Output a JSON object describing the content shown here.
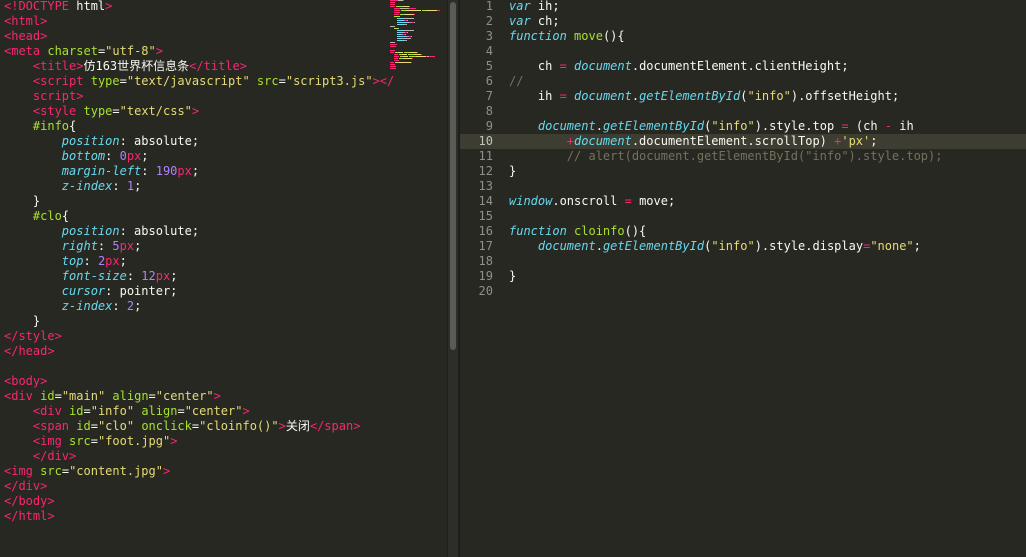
{
  "editor": {
    "left_pane": {
      "lines": [
        [
          [
            "tag",
            "<!DOCTYPE"
          ],
          [
            "pl",
            " html"
          ],
          [
            "tag",
            ">"
          ]
        ],
        [
          [
            "tag",
            "<html>"
          ]
        ],
        [
          [
            "tag",
            "<head>"
          ]
        ],
        [
          [
            "tag",
            "<meta"
          ],
          [
            "pl",
            " "
          ],
          [
            "attr",
            "charset"
          ],
          [
            "pl",
            "="
          ],
          [
            "str",
            "\"utf-8\""
          ],
          [
            "tag",
            ">"
          ]
        ],
        [
          [
            "pl",
            "    "
          ],
          [
            "tag",
            "<title>"
          ],
          [
            "pl",
            "仿163世界杯信息条"
          ],
          [
            "tag",
            "</title>"
          ]
        ],
        [
          [
            "pl",
            "    "
          ],
          [
            "tag",
            "<script"
          ],
          [
            "pl",
            " "
          ],
          [
            "attr",
            "type"
          ],
          [
            "pl",
            "="
          ],
          [
            "str",
            "\"text/javascript\""
          ],
          [
            "pl",
            " "
          ],
          [
            "attr",
            "src"
          ],
          [
            "pl",
            "="
          ],
          [
            "str",
            "\"script3.js\""
          ],
          [
            "tag",
            ">"
          ],
          [
            "tag",
            "</"
          ]
        ],
        [
          [
            "pl",
            "    "
          ],
          [
            "tag",
            "script"
          ],
          [
            "tag",
            ">"
          ]
        ],
        [
          [
            "pl",
            "    "
          ],
          [
            "tag",
            "<style"
          ],
          [
            "pl",
            " "
          ],
          [
            "attr",
            "type"
          ],
          [
            "pl",
            "="
          ],
          [
            "str",
            "\"text/css\""
          ],
          [
            "tag",
            ">"
          ]
        ],
        [
          [
            "pl",
            "    "
          ],
          [
            "attr",
            "#info"
          ],
          [
            "pl",
            "{"
          ]
        ],
        [
          [
            "pl",
            "        "
          ],
          [
            "prop",
            "position"
          ],
          [
            "pl",
            ": absolute;"
          ]
        ],
        [
          [
            "pl",
            "        "
          ],
          [
            "prop",
            "bottom"
          ],
          [
            "pl",
            ": "
          ],
          [
            "num",
            "0"
          ],
          [
            "op",
            "px"
          ],
          [
            "pl",
            ";"
          ]
        ],
        [
          [
            "pl",
            "        "
          ],
          [
            "prop",
            "margin-left"
          ],
          [
            "pl",
            ": "
          ],
          [
            "num",
            "190"
          ],
          [
            "op",
            "px"
          ],
          [
            "pl",
            ";"
          ]
        ],
        [
          [
            "pl",
            "        "
          ],
          [
            "prop",
            "z-index"
          ],
          [
            "pl",
            ": "
          ],
          [
            "num",
            "1"
          ],
          [
            "pl",
            ";"
          ]
        ],
        [
          [
            "pl",
            "    }"
          ]
        ],
        [
          [
            "pl",
            "    "
          ],
          [
            "attr",
            "#clo"
          ],
          [
            "pl",
            "{"
          ]
        ],
        [
          [
            "pl",
            "        "
          ],
          [
            "prop",
            "position"
          ],
          [
            "pl",
            ": absolute;"
          ]
        ],
        [
          [
            "pl",
            "        "
          ],
          [
            "prop",
            "right"
          ],
          [
            "pl",
            ": "
          ],
          [
            "num",
            "5"
          ],
          [
            "op",
            "px"
          ],
          [
            "pl",
            ";"
          ]
        ],
        [
          [
            "pl",
            "        "
          ],
          [
            "prop",
            "top"
          ],
          [
            "pl",
            ": "
          ],
          [
            "num",
            "2"
          ],
          [
            "op",
            "px"
          ],
          [
            "pl",
            ";"
          ]
        ],
        [
          [
            "pl",
            "        "
          ],
          [
            "prop",
            "font-size"
          ],
          [
            "pl",
            ": "
          ],
          [
            "num",
            "12"
          ],
          [
            "op",
            "px"
          ],
          [
            "pl",
            ";"
          ]
        ],
        [
          [
            "pl",
            "        "
          ],
          [
            "prop",
            "cursor"
          ],
          [
            "pl",
            ": pointer;"
          ]
        ],
        [
          [
            "pl",
            "        "
          ],
          [
            "prop",
            "z-index"
          ],
          [
            "pl",
            ": "
          ],
          [
            "num",
            "2"
          ],
          [
            "pl",
            ";"
          ]
        ],
        [
          [
            "pl",
            "    }"
          ]
        ],
        [
          [
            "tag",
            "</style>"
          ]
        ],
        [
          [
            "tag",
            "</head>"
          ]
        ],
        [],
        [
          [
            "tag",
            "<body>"
          ]
        ],
        [
          [
            "tag",
            "<div"
          ],
          [
            "pl",
            " "
          ],
          [
            "attr",
            "id"
          ],
          [
            "pl",
            "="
          ],
          [
            "str",
            "\"main\""
          ],
          [
            "pl",
            " "
          ],
          [
            "attr",
            "align"
          ],
          [
            "pl",
            "="
          ],
          [
            "str",
            "\"center\""
          ],
          [
            "tag",
            ">"
          ]
        ],
        [
          [
            "pl",
            "    "
          ],
          [
            "tag",
            "<div"
          ],
          [
            "pl",
            " "
          ],
          [
            "attr",
            "id"
          ],
          [
            "pl",
            "="
          ],
          [
            "str",
            "\"info\""
          ],
          [
            "pl",
            " "
          ],
          [
            "attr",
            "align"
          ],
          [
            "pl",
            "="
          ],
          [
            "str",
            "\"center\""
          ],
          [
            "tag",
            ">"
          ]
        ],
        [
          [
            "pl",
            "    "
          ],
          [
            "tag",
            "<span"
          ],
          [
            "pl",
            " "
          ],
          [
            "attr",
            "id"
          ],
          [
            "pl",
            "="
          ],
          [
            "str",
            "\"clo\""
          ],
          [
            "pl",
            " "
          ],
          [
            "attr",
            "onclick"
          ],
          [
            "pl",
            "="
          ],
          [
            "str",
            "\"cloinfo()\""
          ],
          [
            "tag",
            ">"
          ],
          [
            "pl",
            "关闭"
          ],
          [
            "tag",
            "</span>"
          ]
        ],
        [
          [
            "pl",
            "    "
          ],
          [
            "tag",
            "<img"
          ],
          [
            "pl",
            " "
          ],
          [
            "attr",
            "src"
          ],
          [
            "pl",
            "="
          ],
          [
            "str",
            "\"foot.jpg\""
          ],
          [
            "tag",
            ">"
          ]
        ],
        [
          [
            "pl",
            "    "
          ],
          [
            "tag",
            "</div>"
          ]
        ],
        [
          [
            "tag",
            "<img"
          ],
          [
            "pl",
            " "
          ],
          [
            "attr",
            "src"
          ],
          [
            "pl",
            "="
          ],
          [
            "str",
            "\"content.jpg\""
          ],
          [
            "tag",
            ">"
          ]
        ],
        [
          [
            "tag",
            "</div>"
          ]
        ],
        [
          [
            "tag",
            "</body>"
          ]
        ],
        [
          [
            "tag",
            "</html>"
          ]
        ]
      ]
    },
    "right_pane": {
      "active_line": 10,
      "line_numbers": [
        "1",
        "2",
        "3",
        "4",
        "5",
        "6",
        "7",
        "8",
        "9",
        "10",
        "11",
        "12",
        "13",
        "14",
        "15",
        "16",
        "17",
        "18",
        "19",
        "20"
      ],
      "lines": [
        [
          [
            "kw",
            "var"
          ],
          [
            "pl",
            " ih;"
          ]
        ],
        [
          [
            "kw",
            "var"
          ],
          [
            "pl",
            " ch;"
          ]
        ],
        [
          [
            "kw",
            "function"
          ],
          [
            "pl",
            " "
          ],
          [
            "fn",
            "move"
          ],
          [
            "pl",
            "(){"
          ]
        ],
        [],
        [
          [
            "pl",
            "    ch "
          ],
          [
            "op",
            "="
          ],
          [
            "pl",
            " "
          ],
          [
            "ob",
            "document"
          ],
          [
            "pl",
            ".documentElement.clientHeight;"
          ]
        ],
        [
          [
            "cmt",
            "//"
          ]
        ],
        [
          [
            "pl",
            "    ih "
          ],
          [
            "op",
            "="
          ],
          [
            "pl",
            " "
          ],
          [
            "ob",
            "document"
          ],
          [
            "pl",
            "."
          ],
          [
            "ob",
            "getElementById"
          ],
          [
            "pl",
            "("
          ],
          [
            "str",
            "\"info\""
          ],
          [
            "pl",
            ")"
          ],
          [
            "pl",
            ".offsetHeight;"
          ]
        ],
        [],
        [
          [
            "pl",
            "    "
          ],
          [
            "ob",
            "document"
          ],
          [
            "pl",
            "."
          ],
          [
            "ob",
            "getElementById"
          ],
          [
            "pl",
            "("
          ],
          [
            "str",
            "\"info\""
          ],
          [
            "pl",
            ")"
          ],
          [
            "pl",
            ".style.top "
          ],
          [
            "op",
            "="
          ],
          [
            "pl",
            " (ch "
          ],
          [
            "op",
            "-"
          ],
          [
            "pl",
            " ih"
          ]
        ],
        [
          [
            "pl",
            "        "
          ],
          [
            "op",
            "+"
          ],
          [
            "ob",
            "document"
          ],
          [
            "pl",
            ".documentElement.scrollTop) "
          ],
          [
            "op",
            "+"
          ],
          [
            "str",
            "'px'"
          ],
          [
            "pl",
            ";"
          ]
        ],
        [
          [
            "cmt",
            "        // alert(document.getElementById(\"info\").style.top);"
          ]
        ],
        [
          [
            "pl",
            "}"
          ]
        ],
        [],
        [
          [
            "ob",
            "window"
          ],
          [
            "pl",
            ".onscroll "
          ],
          [
            "op",
            "="
          ],
          [
            "pl",
            " move;"
          ]
        ],
        [],
        [
          [
            "kw",
            "function"
          ],
          [
            "pl",
            " "
          ],
          [
            "fn",
            "cloinfo"
          ],
          [
            "pl",
            "(){"
          ]
        ],
        [
          [
            "pl",
            "    "
          ],
          [
            "ob",
            "document"
          ],
          [
            "pl",
            "."
          ],
          [
            "ob",
            "getElementById"
          ],
          [
            "pl",
            "("
          ],
          [
            "str",
            "\"info\""
          ],
          [
            "pl",
            ")"
          ],
          [
            "pl",
            ".style.display"
          ],
          [
            "op",
            "="
          ],
          [
            "str",
            "\"none\""
          ],
          [
            "pl",
            ";"
          ]
        ],
        [],
        [
          [
            "pl",
            "}"
          ]
        ],
        []
      ]
    },
    "colors": {
      "background": "#272822",
      "tag": "#f92672",
      "attribute": "#a6e22e",
      "string": "#e6db74",
      "keyword": "#66d9ef",
      "number": "#ae81ff",
      "comment": "#75715e"
    }
  }
}
